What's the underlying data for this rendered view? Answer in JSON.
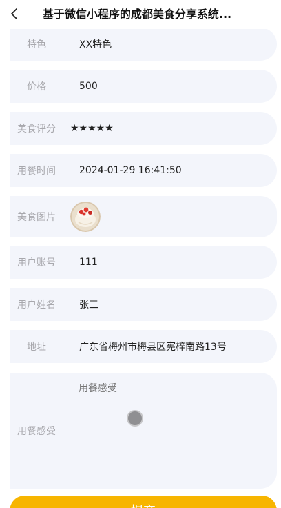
{
  "nav": {
    "title": "基于微信小程序的成都美食分享系统...",
    "back_icon": "chevron-left-icon"
  },
  "fields": {
    "feature": {
      "label": "特色",
      "value": "XX特色"
    },
    "price": {
      "label": "价格",
      "value": "500"
    },
    "rating": {
      "label": "美食评分",
      "value": "★★★★★",
      "score": 5,
      "max": 5,
      "color": "#f6b93b"
    },
    "time": {
      "label": "用餐时间",
      "value": "2024-01-29 16:41:50"
    },
    "image": {
      "label": "美食图片",
      "icon": "cake-thumbnail"
    },
    "account": {
      "label": "用户账号",
      "value": "111"
    },
    "name": {
      "label": "用户姓名",
      "value": "张三"
    },
    "address": {
      "label": "地址",
      "value": "广东省梅州市梅县区宪梓南路13号"
    },
    "feeling": {
      "label": "用餐感受",
      "placeholder": "用餐感受",
      "value": ""
    }
  },
  "submit": {
    "label": "提交"
  },
  "colors": {
    "accent": "#f7b500",
    "field_bg": "#f3f5fb",
    "label": "#a8a8ad"
  }
}
